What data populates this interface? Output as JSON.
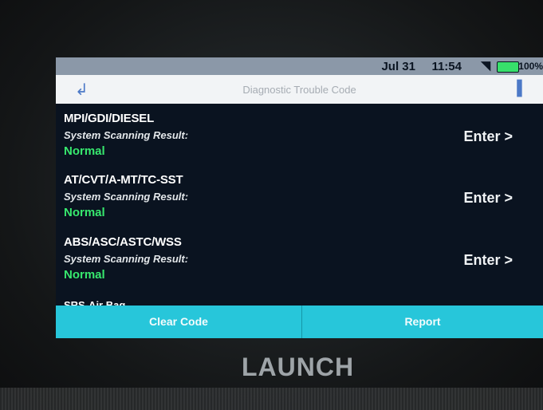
{
  "status_bar": {
    "date": "Jul 31",
    "time": "11:54",
    "battery": "100%"
  },
  "header": {
    "title": "Diagnostic Trouble Code"
  },
  "systems": [
    {
      "name": "MPI/GDI/DIESEL",
      "label": "System Scanning Result:",
      "status": "Normal",
      "action": "Enter >"
    },
    {
      "name": "AT/CVT/A-MT/TC-SST",
      "label": "System Scanning Result:",
      "status": "Normal",
      "action": "Enter >"
    },
    {
      "name": "ABS/ASC/ASTC/WSS",
      "label": "System Scanning Result:",
      "status": "Normal",
      "action": "Enter >"
    }
  ],
  "partial_item": "SRS-Air Bag",
  "buttons": {
    "clear": "Clear Code",
    "report": "Report"
  },
  "brand": "LAUNCH",
  "colors": {
    "normal_status": "#37e86e",
    "button_bar": "#27c6da",
    "battery": "#37e06b"
  }
}
